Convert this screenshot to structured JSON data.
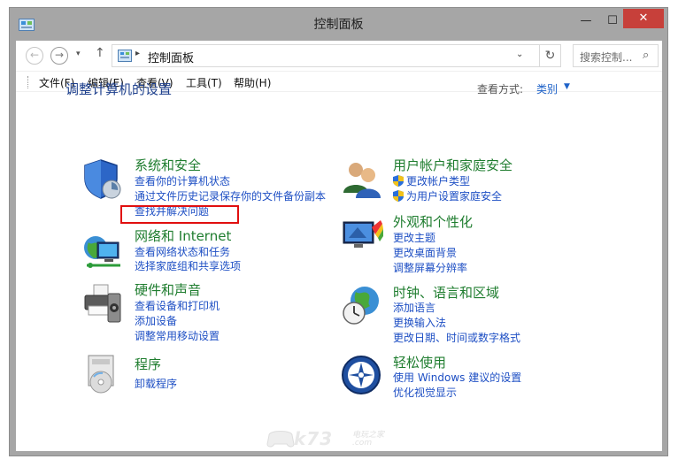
{
  "window": {
    "title": "控制面板"
  },
  "window_controls": {
    "minimize": "—",
    "maximize": "☐",
    "close": "✕"
  },
  "addressbar": {
    "back": "←",
    "forward": "→",
    "recent": "▾",
    "up": "↑",
    "separator": "▸",
    "path": "控制面板",
    "dropdown": "⌄",
    "refresh": "↻",
    "search_placeholder": "搜索控制...",
    "search_icon": "⌕"
  },
  "menu": [
    "文件(F)",
    "编辑(E)",
    "查看(V)",
    "工具(T)",
    "帮助(H)"
  ],
  "main": {
    "title": "调整计算机的设置",
    "view_by_label": "查看方式:",
    "view_by_value": "类别",
    "view_caret": "▼"
  },
  "categories": {
    "system": {
      "title": "系统和安全",
      "links": [
        "查看你的计算机状态",
        "通过文件历史记录保存你的文件备份副本",
        "查找并解决问题"
      ]
    },
    "network": {
      "title": "网络和 Internet",
      "links": [
        "查看网络状态和任务",
        "选择家庭组和共享选项"
      ]
    },
    "hardware": {
      "title": "硬件和声音",
      "links": [
        "查看设备和打印机",
        "添加设备",
        "调整常用移动设置"
      ]
    },
    "programs": {
      "title": "程序",
      "links": [
        "卸载程序"
      ]
    },
    "users": {
      "title": "用户帐户和家庭安全",
      "links": [
        "更改帐户类型",
        "为用户设置家庭安全"
      ]
    },
    "appearance": {
      "title": "外观和个性化",
      "links": [
        "更改主题",
        "更改桌面背景",
        "调整屏幕分辨率"
      ]
    },
    "clock": {
      "title": "时钟、语言和区域",
      "links": [
        "添加语言",
        "更换输入法",
        "更改日期、时间或数字格式"
      ]
    },
    "ease": {
      "title": "轻松使用",
      "links": [
        "使用 Windows 建议的设置",
        "优化视觉显示"
      ]
    }
  },
  "watermark": {
    "text": "k73",
    "sub": "电玩之家",
    "domain": ".com"
  },
  "colors": {
    "accent_green": "#1f7d2f",
    "link_blue": "#1e4fc4",
    "highlight_red": "#e10f0f",
    "close_red": "#c7403a"
  },
  "icons": [
    "control-panel-icon",
    "shield-icon",
    "network-icon",
    "printer-icon",
    "programs-icon",
    "users-icon",
    "monitor-icon",
    "globe-clock-icon",
    "ease-of-access-icon",
    "search-icon"
  ]
}
